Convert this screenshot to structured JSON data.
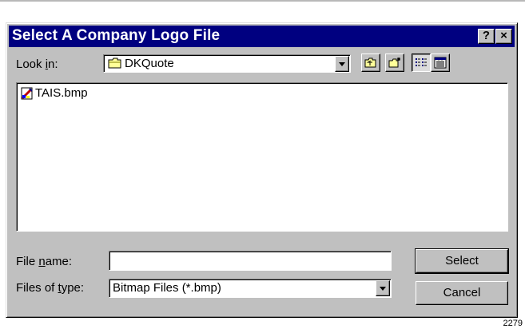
{
  "dialog": {
    "title": "Select A Company Logo File",
    "help_label": "?",
    "close_label": "×"
  },
  "lookin": {
    "label_pre": "Look ",
    "label_key": "i",
    "label_post": "n:",
    "value": "DKQuote",
    "toolbar_icons": [
      "up-one-level-icon",
      "new-folder-icon",
      "list-view-icon",
      "details-view-icon"
    ]
  },
  "files": {
    "items": [
      {
        "name": "TAIS.bmp",
        "icon": "bitmap-file-icon"
      }
    ]
  },
  "filename": {
    "label_pre": "File ",
    "label_key": "n",
    "label_post": "ame:",
    "value": ""
  },
  "filetype": {
    "label_pre": "Files of ",
    "label_key": "t",
    "label_post": "ype:",
    "value": "Bitmap Files (*.bmp)"
  },
  "buttons": {
    "select": "Select",
    "cancel": "Cancel"
  },
  "caption": "2279",
  "colors": {
    "titlebar": "#000080",
    "face": "#c0c0c0",
    "folder": "#ffff99"
  }
}
